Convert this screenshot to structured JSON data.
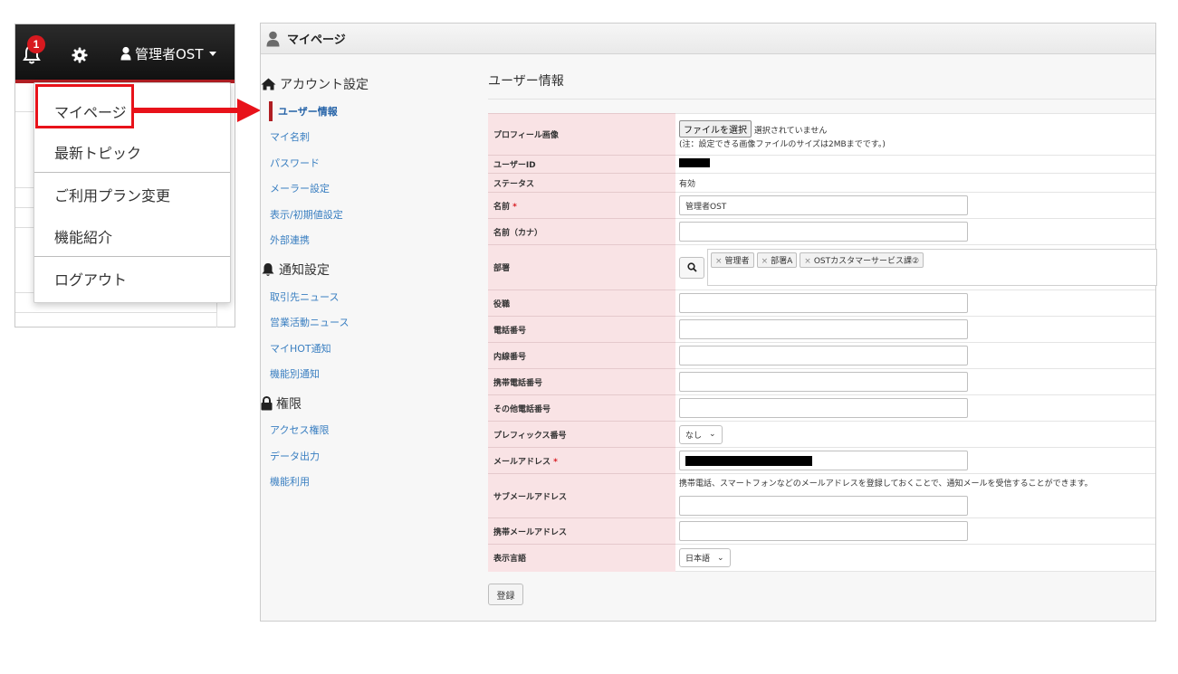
{
  "topbar": {
    "notification_count": "1",
    "user_label": "管理者OST"
  },
  "dropdown": {
    "items": [
      {
        "label": "マイページ"
      },
      {
        "label": "最新トピック"
      },
      {
        "label": "ご利用プラン変更"
      },
      {
        "label": "機能紹介"
      },
      {
        "label": "ログアウト"
      }
    ]
  },
  "page": {
    "header_title": "マイページ",
    "content_title": "ユーザー情報"
  },
  "sidenav": {
    "account_section": "アカウント設定",
    "account_items": [
      "ユーザー情報",
      "マイ名刺",
      "パスワード",
      "メーラー設定",
      "表示/初期値設定",
      "外部連携"
    ],
    "notify_section": "通知設定",
    "notify_items": [
      "取引先ニュース",
      "営業活動ニュース",
      "マイHOT通知",
      "機能別通知"
    ],
    "perm_section": "権限",
    "perm_items": [
      "アクセス権限",
      "データ出力",
      "機能利用"
    ]
  },
  "form": {
    "profile_image_label": "プロフィール画像",
    "file_button": "ファイルを選択",
    "file_status": "選択されていません",
    "file_note": "(注：設定できる画像ファイルのサイズは2MBまでです。)",
    "user_id_label": "ユーザーID",
    "status_label": "ステータス",
    "status_value": "有効",
    "name_label": "名前",
    "required_mark": "*",
    "name_value": "管理者OST",
    "kana_label": "名前（カナ）",
    "dept_label": "部署",
    "dept_tags": [
      "管理者",
      "部署A",
      "OSTカスタマーサービス課②"
    ],
    "tag_remove": "×",
    "title_label": "役職",
    "phone_label": "電話番号",
    "ext_label": "内線番号",
    "mobile_label": "携帯電話番号",
    "other_phone_label": "その他電話番号",
    "prefix_label": "プレフィックス番号",
    "prefix_value": "なし",
    "email_label": "メールアドレス",
    "sub_email_label": "サブメールアドレス",
    "sub_email_note": "携帯電話、スマートフォンなどのメールアドレスを登録しておくことで、通知メールを受信することができます。",
    "mobile_email_label": "携帯メールアドレス",
    "language_label": "表示言語",
    "language_value": "日本語",
    "register_button": "登録"
  },
  "colors": {
    "accent_red": "#e8121a",
    "brand_red": "#b01e23",
    "label_bg": "#f9e3e5",
    "link_blue": "#3a7fc1"
  }
}
